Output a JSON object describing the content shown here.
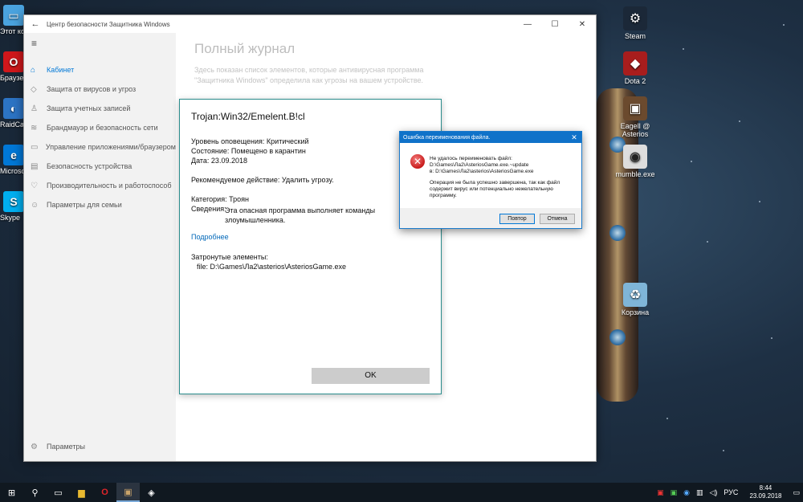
{
  "window": {
    "title": "Центр безопасности Защитника Windows",
    "back": "←",
    "minimize": "—",
    "maximize": "☐",
    "close": "✕"
  },
  "sidebar": {
    "menu_icon": "≡",
    "items": [
      {
        "label": "Кабинет",
        "icon": "home-icon",
        "glyph": "⌂",
        "active": true
      },
      {
        "label": "Защита от вирусов и угроз",
        "icon": "shield-icon",
        "glyph": "◇"
      },
      {
        "label": "Защита учетных записей",
        "icon": "person-icon",
        "glyph": "♙"
      },
      {
        "label": "Брандмауэр и безопасность сети",
        "icon": "wifi-icon",
        "glyph": "≋"
      },
      {
        "label": "Управление приложениями/браузером",
        "icon": "app-icon",
        "glyph": "▭"
      },
      {
        "label": "Безопасность устройства",
        "icon": "device-icon",
        "glyph": "▤"
      },
      {
        "label": "Производительность и работоспособ",
        "icon": "heart-icon",
        "glyph": "♡"
      },
      {
        "label": "Параметры для семьи",
        "icon": "family-icon",
        "glyph": "☺"
      }
    ],
    "settings": {
      "label": "Параметры",
      "icon": "gear-icon",
      "glyph": "⚙"
    }
  },
  "content": {
    "title": "Полный журнал",
    "description": "Здесь показан список элементов, которые антивирусная программа \"Защитника Windows\" определила как угрозы на вашем устройстве."
  },
  "threat": {
    "name": "Trojan:Win32/Emelent.B!cl",
    "alert_level": "Уровень оповещения: Критический",
    "status": "Состояние: Помещено в карантин",
    "date": "Дата: 23.09.2018",
    "recommended": "Рекомендуемое действие: Удалить угрозу.",
    "category": "Категория:  Троян",
    "details_label": "Сведения:",
    "details_value": "Эта опасная программа выполняет команды злоумышленника.",
    "more_link": "Подробнее",
    "affected_label": "Затронутые элементы:",
    "affected_file": "file: D:\\Games\\Ла2\\asterios\\AsteriosGame.exe",
    "ok_label": "OK"
  },
  "error_dialog": {
    "title": "Ошибка переименования файла.",
    "close": "✕",
    "icon_glyph": "✕",
    "line1": "Не удалось переименовать файл:",
    "line2": "D:\\Games\\Ла2\\AsteriosGame.exe.~update",
    "line3": "в: D:\\Games\\Ла2\\asterios\\AsteriosGame.exe",
    "line4": "Операция не была успешно завершена, так как файл содержит вирус или потенциально нежелательную программу.",
    "retry_label": "Повтор",
    "cancel_label": "Отмена"
  },
  "desktop_right": [
    {
      "label": "Steam",
      "icon": "steam-icon",
      "glyph": "⚙",
      "color": "#1b2838"
    },
    {
      "label": "Dota 2",
      "icon": "dota-icon",
      "glyph": "◆",
      "color": "#a81d1d"
    },
    {
      "label": "Eagell @ Asterios",
      "icon": "game-icon",
      "glyph": "▣",
      "color": "#6b4a2e"
    },
    {
      "label": "mumble.exe",
      "icon": "mumble-icon",
      "glyph": "◉",
      "color": "#dddddd"
    },
    {
      "label": "Корзина",
      "icon": "recycle-bin-icon",
      "glyph": "🗑",
      "color": "#7fb5d8"
    }
  ],
  "desktop_left": [
    {
      "label": "Этот компьютер",
      "icon": "computer-icon",
      "glyph": "▭",
      "color": "#4aa3df"
    },
    {
      "label": "Браузер Opera",
      "icon": "opera-icon",
      "glyph": "O",
      "color": "#d0171b"
    },
    {
      "label": "RaidCall",
      "icon": "raidcall-icon",
      "glyph": "◐",
      "color": "#2c74c4"
    },
    {
      "label": "Microsoft Edge",
      "icon": "edge-icon",
      "glyph": "e",
      "color": "#0078d7"
    },
    {
      "label": "Skype",
      "icon": "skype-icon",
      "glyph": "S",
      "color": "#00aff0"
    }
  ],
  "taskbar": {
    "start": "⊞",
    "search": "⚲",
    "taskview": "▭",
    "explorer": "▆",
    "opera": "O",
    "game": "▣",
    "defender": "◈",
    "language": "РУС",
    "time": "8:44",
    "date": "23.09.2018"
  }
}
